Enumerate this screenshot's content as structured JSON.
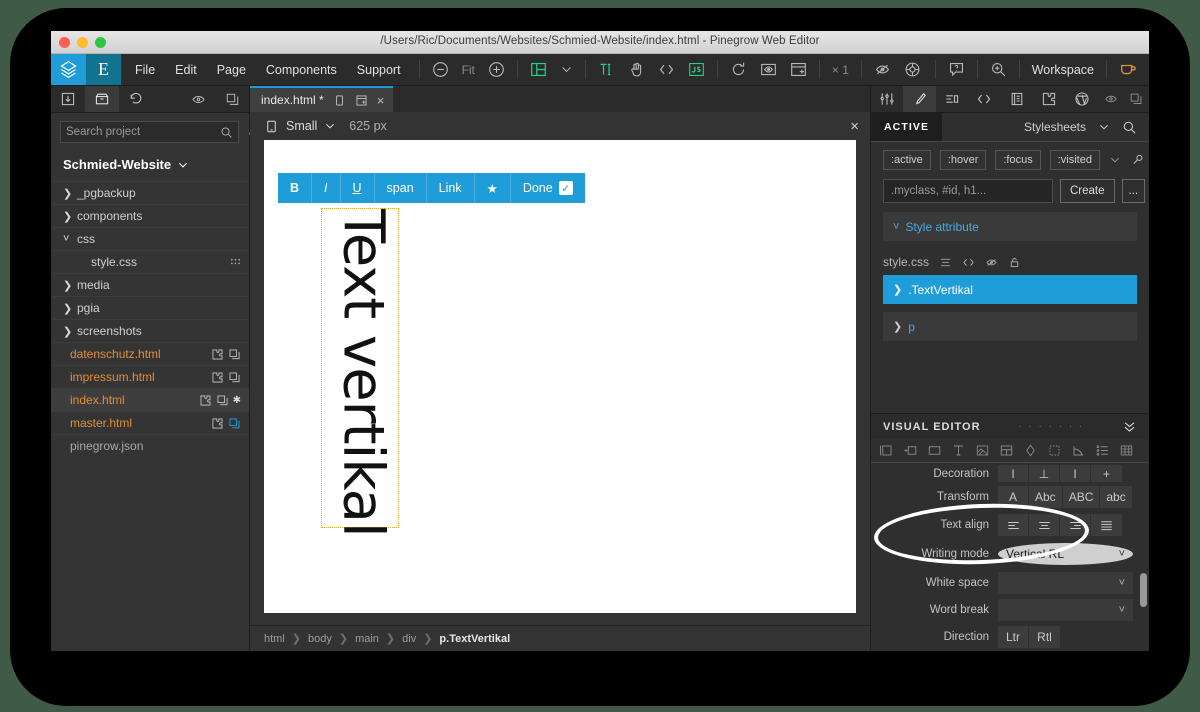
{
  "window": {
    "title": "/Users/Ric/Documents/Websites/Schmied-Website/index.html - Pinegrow Web Editor",
    "traffic_lights": [
      "close",
      "minimize",
      "zoom"
    ]
  },
  "menubar": {
    "items": [
      "File",
      "Edit",
      "Page",
      "Components",
      "Support"
    ],
    "zoom_fit_label": "Fit",
    "scale_label": "× 1",
    "workspace_label": "Workspace",
    "icons": [
      "zoom-out-icon",
      "zoom-in-icon",
      "grid-layout-icon",
      "chevron-down-icon",
      "text-edit-icon",
      "interact-icon",
      "code-icon",
      "js-icon",
      "reload-icon",
      "preview-icon",
      "new-window-icon",
      "hide-icon",
      "target-icon",
      "help-icon",
      "magnifier-icon",
      "coffee-icon"
    ],
    "accent_blue": "#1f9dd9",
    "accent_teal": "#11738f",
    "accent_green": "#23d18b",
    "accent_orange": "#e08e38"
  },
  "left_panel": {
    "tabs": [
      "import-icon",
      "box-icon",
      "undo-icon"
    ],
    "tab_right_icons": [
      "eye-icon",
      "copy-icon"
    ],
    "search": {
      "placeholder": "Search project",
      "value": ""
    },
    "settings_icon": "sliders-icon",
    "project_name": "Schmied-Website",
    "tree": [
      {
        "label": "_pgbackup",
        "type": "folder",
        "expanded": false,
        "indent": 0
      },
      {
        "label": "components",
        "type": "folder",
        "expanded": false,
        "indent": 0
      },
      {
        "label": "css",
        "type": "folder",
        "expanded": true,
        "indent": 0
      },
      {
        "label": "style.css",
        "type": "file-plain",
        "indent": 1,
        "right": "grip"
      },
      {
        "label": "media",
        "type": "folder",
        "expanded": false,
        "indent": 0
      },
      {
        "label": "pgia",
        "type": "folder",
        "expanded": false,
        "indent": 0
      },
      {
        "label": "screenshots",
        "type": "folder",
        "expanded": false,
        "indent": 0
      },
      {
        "label": "datenschutz.html",
        "type": "file",
        "indent": 0,
        "right": "puzzle-copy"
      },
      {
        "label": "impressum.html",
        "type": "file",
        "indent": 0,
        "right": "puzzle-copy"
      },
      {
        "label": "index.html",
        "type": "file",
        "indent": 0,
        "right": "puzzle-copy-star",
        "selected": true
      },
      {
        "label": "master.html",
        "type": "file",
        "indent": 0,
        "right": "puzzle-copy-blue"
      },
      {
        "label": "pinegrow.json",
        "type": "file-plain2",
        "indent": 0,
        "right": ""
      }
    ]
  },
  "center": {
    "doc_tab": {
      "label": "index.html *",
      "icons": [
        "device-icon",
        "new-page-icon"
      ],
      "close": "×"
    },
    "device": {
      "name": "Small",
      "width": "625 px",
      "icon": "phone-icon",
      "close": "×"
    },
    "format_toolbar": {
      "buttons": [
        {
          "label": "B",
          "style": "bold",
          "name": "bold"
        },
        {
          "label": "I",
          "style": "italic",
          "name": "italic"
        },
        {
          "label": "U",
          "style": "underline",
          "name": "underline"
        },
        {
          "label": "span",
          "style": "plain",
          "name": "span"
        },
        {
          "label": "Link",
          "style": "plain",
          "name": "link"
        },
        {
          "label": "★",
          "style": "plain",
          "name": "star"
        },
        {
          "label": "Done",
          "style": "plain",
          "name": "done",
          "check": "✓"
        }
      ],
      "background": "#1f9dd9"
    },
    "canvas_text": "Text vertikal",
    "selection_outline_color": "#f0a500",
    "breadcrumb": [
      "html",
      "body",
      "main",
      "div",
      "p.TextVertikal"
    ]
  },
  "right_panel": {
    "tabs": [
      "sliders-icon",
      "brush-icon",
      "properties-icon",
      "code-icon",
      "library-icon",
      "plugin-icon",
      "wordpress-icon"
    ],
    "tab_right_icons": [
      "eye-icon",
      "copy-icon"
    ],
    "active_chip": "ACTIVE",
    "stylesheets_label": "Stylesheets",
    "search_icon": "search-icon",
    "pseudo_classes": [
      ":active",
      ":hover",
      ":focus",
      ":visited"
    ],
    "pseudo_extra_icons": [
      "chevron-down-icon",
      "pin-icon"
    ],
    "selector_input": {
      "placeholder": ".myclass, #id, h1...",
      "value": ""
    },
    "create_button": "Create",
    "more_button": "...",
    "style_attribute_label": "Style attribute",
    "stylesheet_file": "style.css",
    "stylesheet_icons": [
      "list-icon",
      "code-icon",
      "hide-icon",
      "lock-icon"
    ],
    "rules": [
      {
        "label": ".TextVertikal",
        "selected": true
      },
      {
        "label": "p",
        "selected": false
      }
    ],
    "visual_editor": {
      "title": "VISUAL EDITOR",
      "dots": "· · · · · · ·",
      "collapse_icon": "chevron-double-down-icon",
      "category_icons": [
        "layout-icon",
        "position-icon",
        "box-icon",
        "typography-icon",
        "background-icon",
        "grid-icon",
        "effects-icon",
        "transform-icon",
        "transition-icon",
        "list-icon",
        "table-icon"
      ],
      "properties": [
        {
          "label": "Decoration",
          "type": "segmented",
          "options": [
            "I",
            "⊥",
            "I",
            "+"
          ],
          "value": ""
        },
        {
          "label": "Transform",
          "type": "segmented",
          "options": [
            "A",
            "Abc",
            "ABC",
            "abc"
          ],
          "value": ""
        },
        {
          "label": "Text align",
          "type": "segmented-icons",
          "options": [
            "align-left",
            "align-center",
            "align-right",
            "align-justify"
          ],
          "value": ""
        },
        {
          "label": "Writing mode",
          "type": "select",
          "value": "Vertical RL",
          "highlighted": true
        },
        {
          "label": "White space",
          "type": "select",
          "value": ""
        },
        {
          "label": "Word break",
          "type": "select",
          "value": ""
        },
        {
          "label": "Direction",
          "type": "segmented",
          "options": [
            "Ltr",
            "Rtl"
          ],
          "value": ""
        }
      ]
    }
  },
  "annotation": {
    "shape": "ellipse",
    "color": "#ffffff",
    "targets": "writing-mode-row"
  }
}
